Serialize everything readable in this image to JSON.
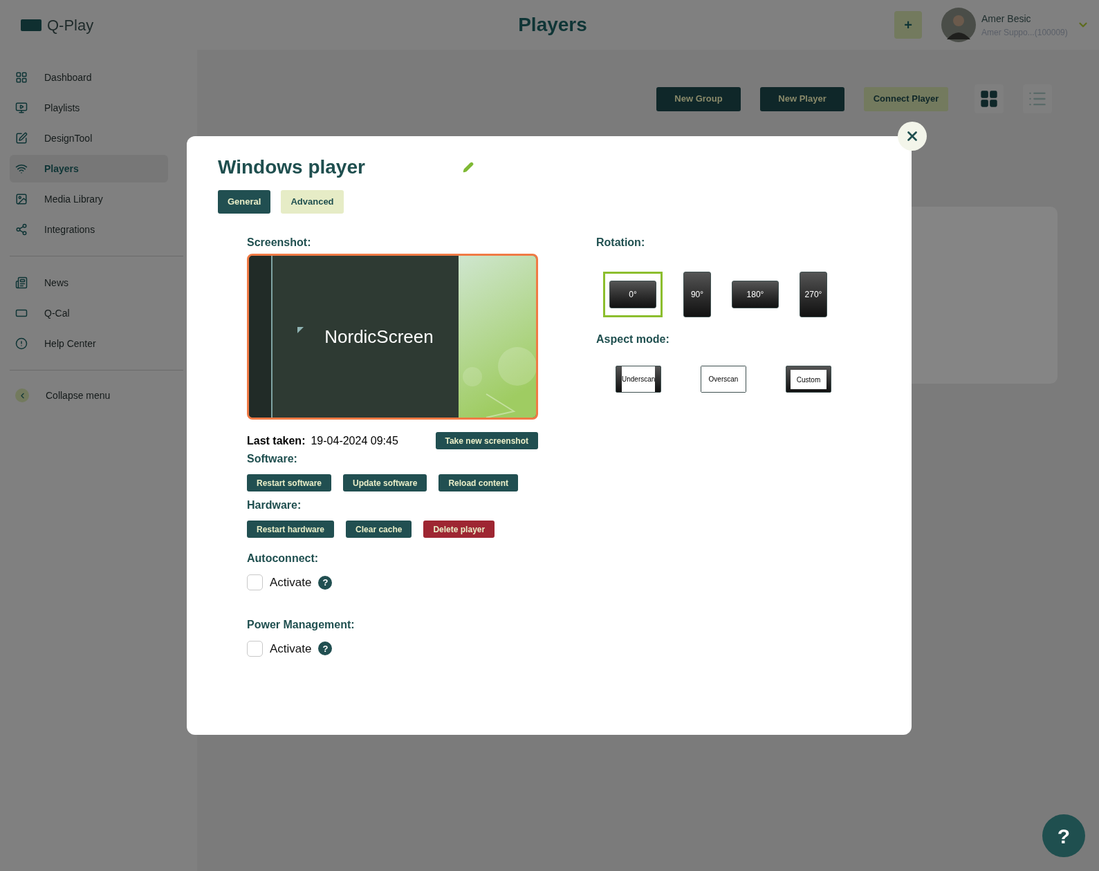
{
  "app": {
    "logo": "Q-Play"
  },
  "header": {
    "title": "Players",
    "add_button": "+",
    "user": {
      "name": "Amer Besic",
      "account": "Amer Suppo...(100009)"
    }
  },
  "sidebar": {
    "groups": [
      {
        "items": [
          {
            "label": "Dashboard",
            "kind": "dashboard",
            "selected": false
          },
          {
            "label": "Playlists",
            "kind": "playlists",
            "selected": false
          },
          {
            "label": "DesignTool",
            "kind": "design",
            "selected": false
          },
          {
            "label": "Players",
            "kind": "players",
            "selected": true
          },
          {
            "label": "Media Library",
            "kind": "media",
            "selected": false
          },
          {
            "label": "Integrations",
            "kind": "integrations",
            "selected": false
          }
        ]
      },
      {
        "items": [
          {
            "label": "News",
            "kind": "news",
            "selected": false
          },
          {
            "label": "Q-Cal",
            "kind": "calendar",
            "selected": false
          },
          {
            "label": "Help Center",
            "kind": "help",
            "selected": false
          }
        ]
      }
    ],
    "collapse_label": "Collapse menu"
  },
  "toolbar": {
    "buttons": [
      {
        "label": "New Group",
        "kind": "dark"
      },
      {
        "label": "New Player",
        "kind": "dark"
      },
      {
        "label": "Connect Player",
        "kind": "light"
      }
    ],
    "views": [
      {
        "kind": "grid",
        "selected": true
      },
      {
        "kind": "list",
        "selected": false
      }
    ]
  },
  "modal": {
    "title": "Windows player",
    "tabs": [
      {
        "label": "General",
        "selected": true
      },
      {
        "label": "Advanced",
        "selected": false
      }
    ],
    "screenshot": {
      "label": "Screenshot:",
      "preview_text": "NordicScreen",
      "last_taken_label": "Last taken:",
      "last_taken": "19-04-2024 09:45",
      "button": "Take new screenshot"
    },
    "software": {
      "label": "Software:",
      "buttons": [
        {
          "label": "Restart software",
          "kind": "normal"
        },
        {
          "label": "Update software",
          "kind": "normal"
        },
        {
          "label": "Reload content",
          "kind": "normal"
        }
      ]
    },
    "hardware": {
      "label": "Hardware:",
      "buttons": [
        {
          "label": "Restart hardware",
          "kind": "normal"
        },
        {
          "label": "Clear cache",
          "kind": "normal"
        },
        {
          "label": "Delete player",
          "kind": "danger"
        }
      ]
    },
    "settings": [
      {
        "label": "Autoconnect:",
        "option": "Activate",
        "checked": false,
        "help": "?"
      },
      {
        "label": "Power Management:",
        "option": "Activate",
        "checked": false,
        "help": "?"
      }
    ],
    "rotation": {
      "label": "Rotation:",
      "options": [
        {
          "label": "0°",
          "kind": "landscape",
          "selected": true
        },
        {
          "label": "90°",
          "kind": "portrait",
          "selected": false
        },
        {
          "label": "180°",
          "kind": "landscape",
          "selected": false
        },
        {
          "label": "270°",
          "kind": "portrait",
          "selected": false
        }
      ]
    },
    "aspect": {
      "label": "Aspect mode:",
      "options": [
        {
          "label": "Underscan",
          "kind": "underscan"
        },
        {
          "label": "Overscan",
          "kind": "overscan"
        },
        {
          "label": "Custom",
          "kind": "custom"
        }
      ]
    }
  },
  "help_button": "?"
}
